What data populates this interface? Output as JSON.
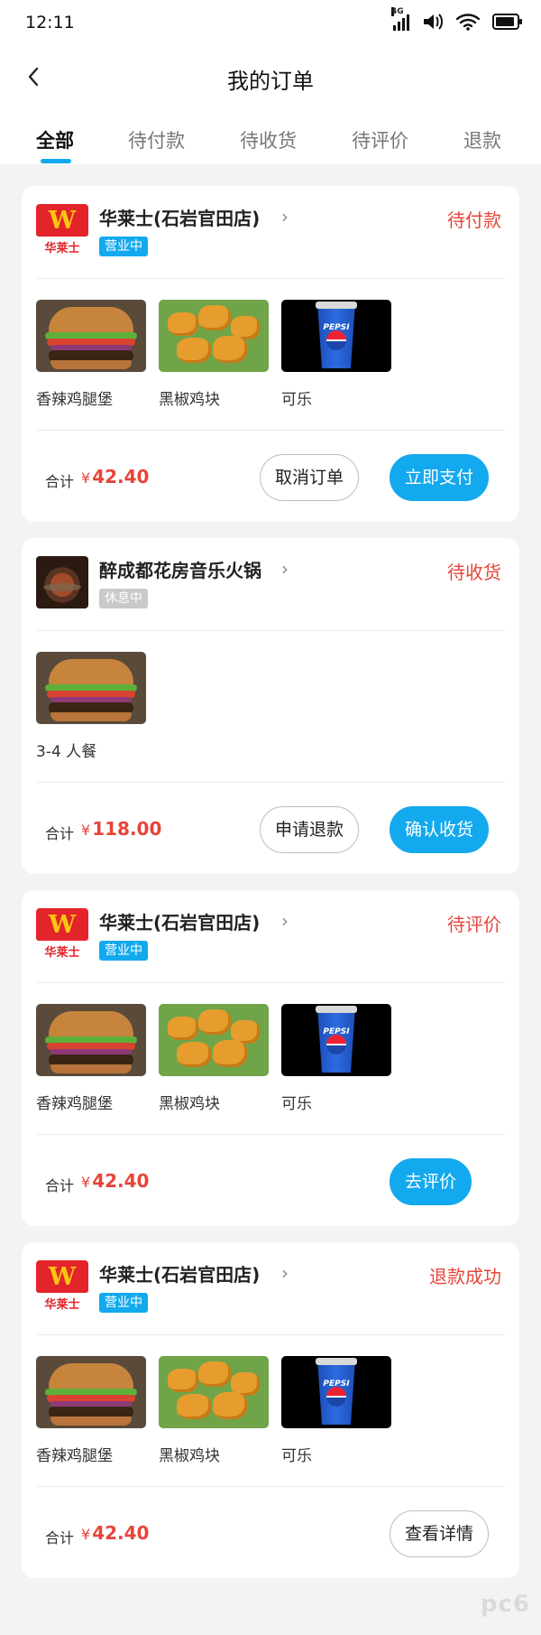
{
  "status_bar": {
    "time": "12:11",
    "network": "4G",
    "icons": [
      "signal-icon",
      "volume-icon",
      "wifi-icon",
      "battery-icon"
    ]
  },
  "header": {
    "title": "我的订单",
    "back_icon": "chevron-left-icon"
  },
  "tabs": [
    {
      "label": "全部",
      "active": true
    },
    {
      "label": "待付款",
      "active": false
    },
    {
      "label": "待收货",
      "active": false
    },
    {
      "label": "待评价",
      "active": false
    },
    {
      "label": "退款",
      "active": false
    }
  ],
  "colors": {
    "accent": "#13a9ee",
    "price": "#e8443a",
    "status": "#e8443a",
    "badge_closed": "#c9c9c9"
  },
  "orders": [
    {
      "store_name": "华莱士(石岩官田店)",
      "logo_text": "华莱士",
      "logo_letter": "W",
      "badge": "营业中",
      "status": "待付款",
      "items": [
        {
          "name": "香辣鸡腿堡",
          "image": "burger"
        },
        {
          "name": "黑椒鸡块",
          "image": "nuggets"
        },
        {
          "name": "可乐",
          "image": "cola"
        }
      ],
      "total_label": "合计",
      "currency": "¥",
      "total": "42.40",
      "buttons": [
        "取消订单",
        "立即支付"
      ]
    },
    {
      "store_name": "醉成都花房音乐火锅",
      "badge": "休息中",
      "status": "待收货",
      "items": [
        {
          "name": "3-4 人餐",
          "image": "burger"
        }
      ],
      "total_label": "合计",
      "currency": "¥",
      "total": "118.00",
      "buttons": [
        "申请退款",
        "确认收货"
      ]
    },
    {
      "store_name": "华莱士(石岩官田店)",
      "logo_text": "华莱士",
      "logo_letter": "W",
      "badge": "营业中",
      "status": "待评价",
      "items": [
        {
          "name": "香辣鸡腿堡",
          "image": "burger"
        },
        {
          "name": "黑椒鸡块",
          "image": "nuggets"
        },
        {
          "name": "可乐",
          "image": "cola"
        }
      ],
      "total_label": "合计",
      "currency": "¥",
      "total": "42.40",
      "buttons": [
        "去评价"
      ]
    },
    {
      "store_name": "华莱士(石岩官田店)",
      "logo_text": "华莱士",
      "logo_letter": "W",
      "badge": "营业中",
      "status": "退款成功",
      "items": [
        {
          "name": "香辣鸡腿堡",
          "image": "burger"
        },
        {
          "name": "黑椒鸡块",
          "image": "nuggets"
        },
        {
          "name": "可乐",
          "image": "cola"
        }
      ],
      "total_label": "合计",
      "currency": "¥",
      "total": "42.40",
      "buttons": [
        "查看详情"
      ]
    }
  ],
  "cola_logo_text": "PEPSI",
  "watermark": "pc6"
}
